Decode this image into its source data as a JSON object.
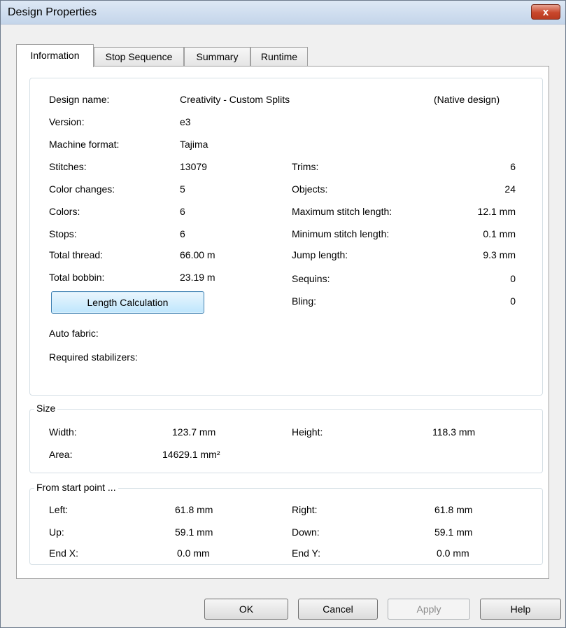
{
  "window": {
    "title": "Design Properties",
    "close_label": "x"
  },
  "tabs": [
    {
      "label": "Information",
      "active": true
    },
    {
      "label": "Stop Sequence",
      "active": false
    },
    {
      "label": "Summary",
      "active": false
    },
    {
      "label": "Runtime",
      "active": false
    }
  ],
  "info": {
    "design_name_label": "Design name:",
    "design_name_value": "Creativity - Custom Splits",
    "native_note": "(Native design)",
    "version_label": "Version:",
    "version_value": "e3",
    "machine_format_label": "Machine format:",
    "machine_format_value": "Tajima",
    "stitches_label": "Stitches:",
    "stitches_value": "13079",
    "color_changes_label": "Color changes:",
    "color_changes_value": "5",
    "colors_label": "Colors:",
    "colors_value": "6",
    "stops_label": "Stops:",
    "stops_value": "6",
    "total_thread_label": "Total thread:",
    "total_thread_value": "66.00 m",
    "total_bobbin_label": "Total bobbin:",
    "total_bobbin_value": "23.19 m",
    "trims_label": "Trims:",
    "trims_value": "6",
    "objects_label": "Objects:",
    "objects_value": "24",
    "max_stitch_label": "Maximum stitch length:",
    "max_stitch_value": "12.1 mm",
    "min_stitch_label": "Minimum stitch length:",
    "min_stitch_value": "0.1 mm",
    "jump_label": "Jump length:",
    "jump_value": "9.3 mm",
    "sequins_label": "Sequins:",
    "sequins_value": "0",
    "bling_label": "Bling:",
    "bling_value": "0",
    "length_calc_button": "Length Calculation",
    "auto_fabric_label": "Auto fabric:",
    "required_stabilizers_label": "Required stabilizers:"
  },
  "size": {
    "group_label": "Size",
    "width_label": "Width:",
    "width_value": "123.7 mm",
    "height_label": "Height:",
    "height_value": "118.3 mm",
    "area_label": "Area:",
    "area_value": "14629.1 mm²"
  },
  "start": {
    "group_label": "From start point ...",
    "left_label": "Left:",
    "left_value": "61.8 mm",
    "right_label": "Right:",
    "right_value": "61.8 mm",
    "up_label": "Up:",
    "up_value": "59.1 mm",
    "down_label": "Down:",
    "down_value": "59.1 mm",
    "endx_label": "End X:",
    "endx_value": "0.0 mm",
    "endy_label": "End Y:",
    "endy_value": "0.0 mm"
  },
  "buttons": {
    "ok": "OK",
    "cancel": "Cancel",
    "apply": "Apply",
    "help": "Help"
  }
}
